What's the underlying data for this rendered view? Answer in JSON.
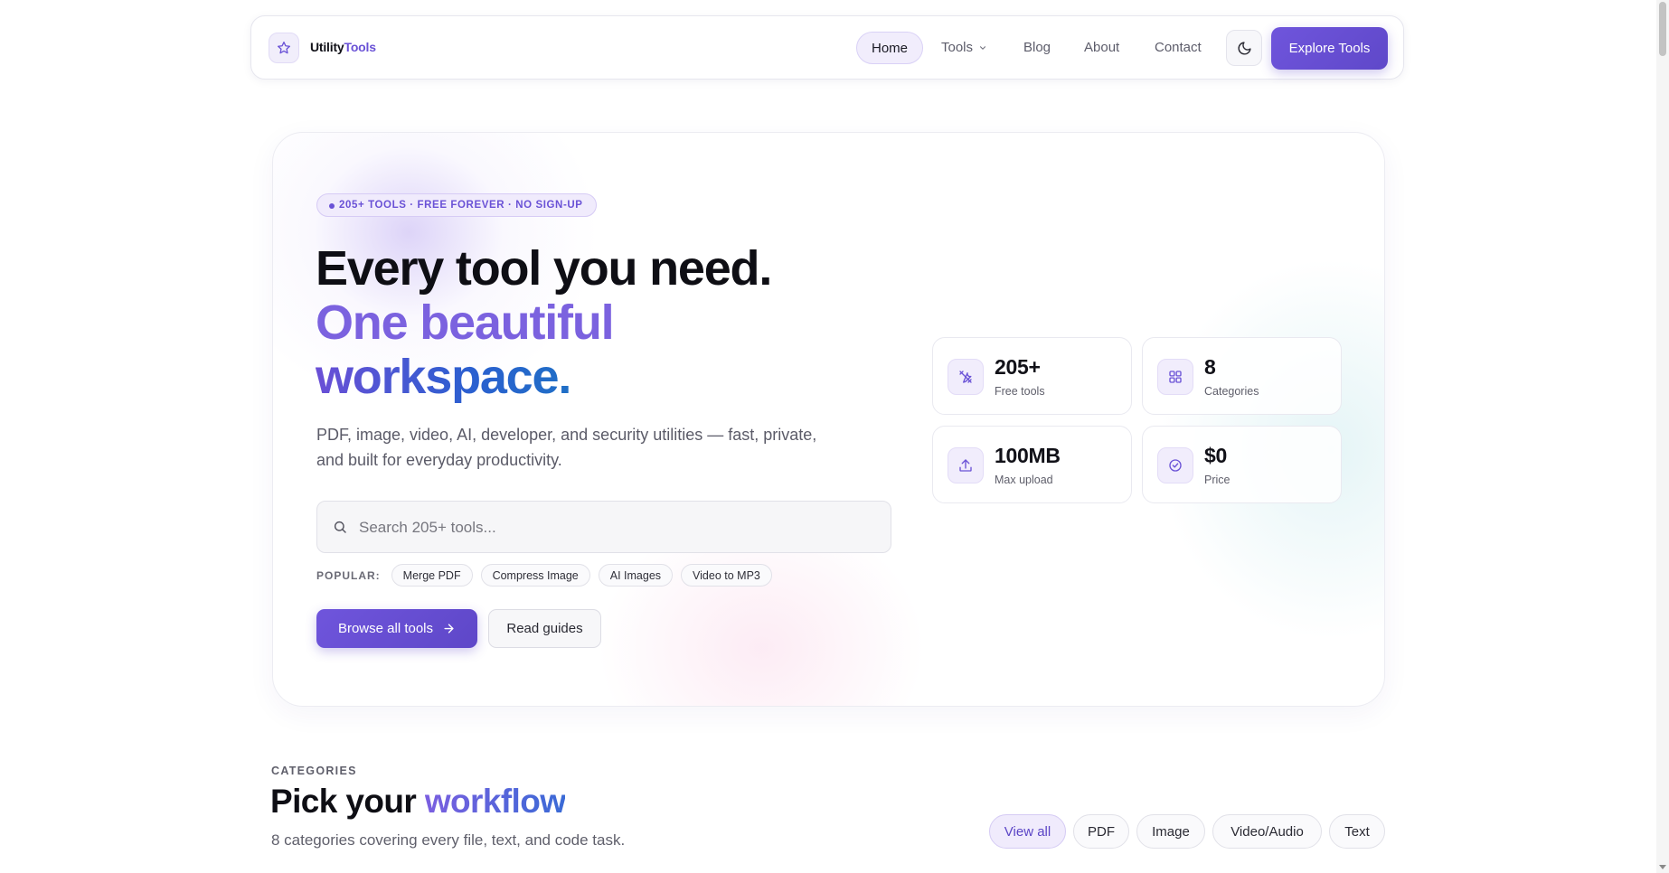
{
  "navbar": {
    "brand_bold": "Utility",
    "brand_accent": "Tools",
    "links": {
      "home": "Home",
      "tools": "Tools",
      "blog": "Blog",
      "about": "About",
      "contact": "Contact"
    },
    "cta": "Explore Tools"
  },
  "hero": {
    "badge": "205+ TOOLS · FREE FOREVER · NO SIGN-UP",
    "headline_line1": "Every tool you need.",
    "headline_line2": "One beautiful",
    "headline_line3": "workspace.",
    "subtitle": "PDF, image, video, AI, developer, and security utilities — fast, private, and built for everyday productivity.",
    "search_placeholder": "Search 205+ tools...",
    "popular_label": "POPULAR:",
    "popular": [
      "Merge PDF",
      "Compress Image",
      "AI Images",
      "Video to MP3"
    ],
    "primary_button": "Browse all tools",
    "secondary_button": "Read guides",
    "stats": [
      {
        "value": "205+",
        "label": "Free tools",
        "icon": "tools-icon"
      },
      {
        "value": "8",
        "label": "Categories",
        "icon": "grid-icon"
      },
      {
        "value": "100MB",
        "label": "Max upload",
        "icon": "upload-icon"
      },
      {
        "value": "$0",
        "label": "Price",
        "icon": "check-circle-icon"
      }
    ]
  },
  "categories": {
    "eyebrow": "CATEGORIES",
    "title_plain": "Pick your ",
    "title_accent": "workflow",
    "subtitle": "8 categories covering every file, text, and code task.",
    "filters": [
      "View all",
      "PDF",
      "Image",
      "Video/Audio",
      "Text"
    ],
    "active_filter": "View all"
  },
  "colors": {
    "accent": "#6a52d6",
    "accent_light": "#f1edfc",
    "text": "#111118"
  }
}
